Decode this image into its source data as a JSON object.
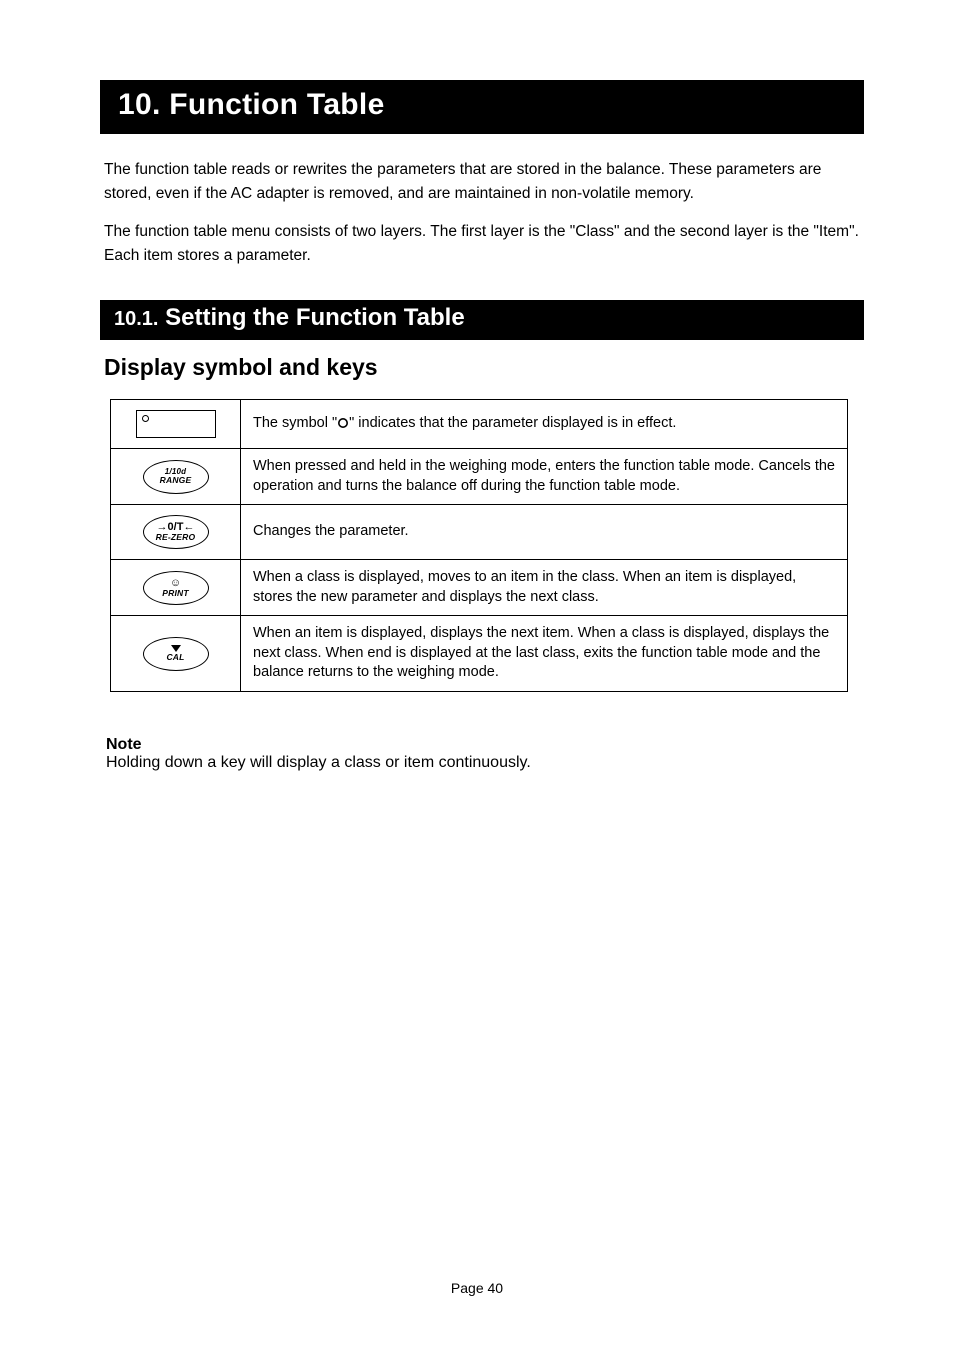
{
  "chapter": {
    "number": "10.",
    "title": "Function Table"
  },
  "intro": {
    "p1": "The function table reads or rewrites the parameters that are stored in the balance. These parameters are stored, even if the AC adapter is removed, and are maintained in non-volatile memory.",
    "p2": "The function table menu consists of two layers. The first layer is the \"Class\" and the second layer is the \"Item\". Each item stores a parameter."
  },
  "section": {
    "number": "10.1.",
    "title": "Setting the Function Table"
  },
  "subhead": "Display symbol and keys",
  "rows": [
    {
      "desc_html": "The symbol \"<svg class='circle-inline' width='12' height='12'><circle cx='6' cy='6' r='4.2' fill='none' stroke='#000' stroke-width='1.6'/></svg>\" indicates that the parameter displayed is in effect."
    },
    {
      "key_line1": "1/10d",
      "key_line2": "RANGE",
      "desc": "When pressed and held in the weighing mode, enters the function table mode. Cancels the operation and turns the balance off during the function table mode."
    },
    {
      "key_glyph": "→0/T←",
      "key_line2": "RE-ZERO",
      "desc": "Changes the parameter."
    },
    {
      "key_glyph": "☺",
      "key_line2": "PRINT",
      "desc": "When a class is displayed, moves to an item in the class. When an item is displayed, stores the new parameter and displays the next class."
    },
    {
      "key_tri": true,
      "key_line2": "CAL",
      "desc": "When an item is displayed, displays the next item. When a class is displayed, displays the next class. When end is displayed at the last class, exits the function table mode and the balance returns to the weighing mode."
    }
  ],
  "note": {
    "label": "Note",
    "text": "Holding down a key will display a class or item continuously."
  },
  "footer": "Page 40"
}
